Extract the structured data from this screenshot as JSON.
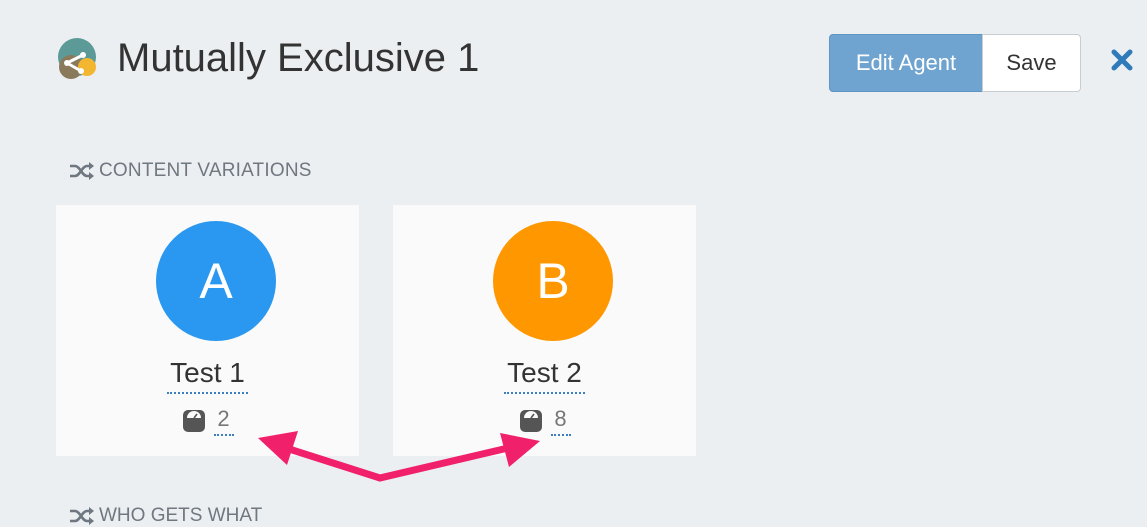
{
  "header": {
    "title": "Mutually Exclusive 1",
    "edit_label": "Edit Agent",
    "save_label": "Save",
    "close_icon": "close-icon",
    "agent_icon": "agent-avatar-icon"
  },
  "content_variations": {
    "heading": "CONTENT VARIATIONS",
    "icon": "shuffle-icon",
    "variations": [
      {
        "letter": "A",
        "name": "Test 1",
        "weight": "2",
        "color": "#2a98f0"
      },
      {
        "letter": "B",
        "name": "Test 2",
        "weight": "8",
        "color": "#ff9800"
      }
    ]
  },
  "next_section": {
    "heading": "WHO GETS WHAT",
    "icon": "shuffle-icon"
  },
  "colors": {
    "background": "#eceff2",
    "primary_button": "#6fa4d0",
    "close_icon": "#2f7ab8",
    "annotation_arrow": "#f0206b"
  }
}
